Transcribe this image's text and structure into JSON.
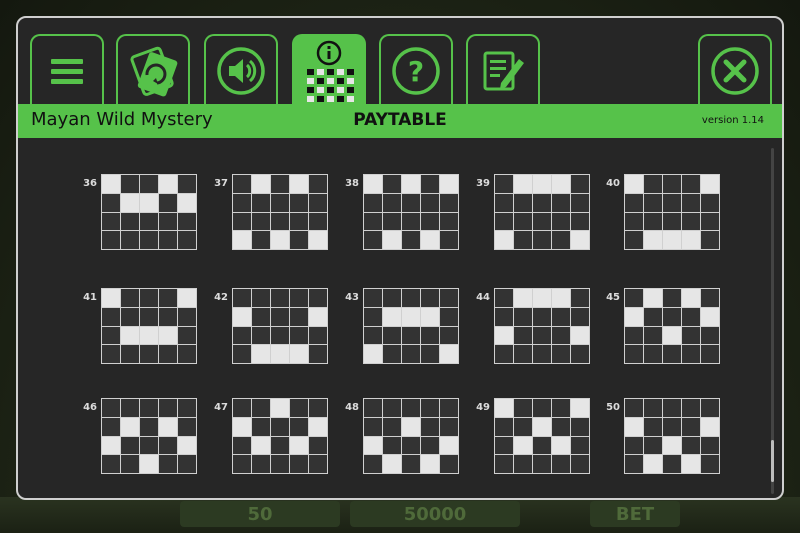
{
  "window": {
    "game_title": "Mayan Wild Mystery",
    "section_title": "PAYTABLE",
    "version": "version 1.14"
  },
  "background": {
    "top_text": "",
    "lines_value": "50",
    "total_bet_value": "50000",
    "bet_label": "BET"
  },
  "tabs": [
    {
      "name": "menu",
      "icon": "hamburger-menu-icon",
      "active": false
    },
    {
      "name": "autoplay",
      "icon": "card-refresh-icon",
      "active": false
    },
    {
      "name": "sound",
      "icon": "speaker-icon",
      "active": false
    },
    {
      "name": "paytable",
      "icon": "info-paytable-icon",
      "active": true
    },
    {
      "name": "help",
      "icon": "question-mark-icon",
      "active": false
    },
    {
      "name": "history",
      "icon": "notepad-pen-icon",
      "active": false
    },
    {
      "name": "close",
      "icon": "close-x-icon",
      "active": false
    }
  ],
  "colors": {
    "accent": "#56c24a",
    "panel_bg": "#262626",
    "cell_off": "#333333",
    "cell_on": "#e6e6e6"
  },
  "paylines": [
    {
      "number": "36",
      "rows": [
        0,
        1,
        1,
        0,
        1
      ]
    },
    {
      "number": "37",
      "rows": [
        3,
        0,
        3,
        0,
        3
      ]
    },
    {
      "number": "38",
      "rows": [
        0,
        3,
        0,
        3,
        0
      ]
    },
    {
      "number": "39",
      "rows": [
        3,
        0,
        0,
        0,
        3
      ]
    },
    {
      "number": "40",
      "rows": [
        0,
        3,
        3,
        3,
        0
      ]
    },
    {
      "number": "41",
      "rows": [
        0,
        2,
        2,
        2,
        0
      ]
    },
    {
      "number": "42",
      "rows": [
        1,
        3,
        3,
        3,
        1
      ]
    },
    {
      "number": "43",
      "rows": [
        3,
        1,
        1,
        1,
        3
      ]
    },
    {
      "number": "44",
      "rows": [
        2,
        0,
        0,
        0,
        2
      ]
    },
    {
      "number": "45",
      "rows": [
        1,
        0,
        2,
        0,
        1
      ]
    },
    {
      "number": "46",
      "rows": [
        2,
        1,
        3,
        1,
        2
      ]
    },
    {
      "number": "47",
      "rows": [
        1,
        2,
        0,
        2,
        1
      ]
    },
    {
      "number": "48",
      "rows": [
        2,
        3,
        1,
        3,
        2
      ]
    },
    {
      "number": "49",
      "rows": [
        0,
        2,
        1,
        2,
        0
      ]
    },
    {
      "number": "50",
      "rows": [
        1,
        3,
        2,
        3,
        1
      ]
    }
  ]
}
